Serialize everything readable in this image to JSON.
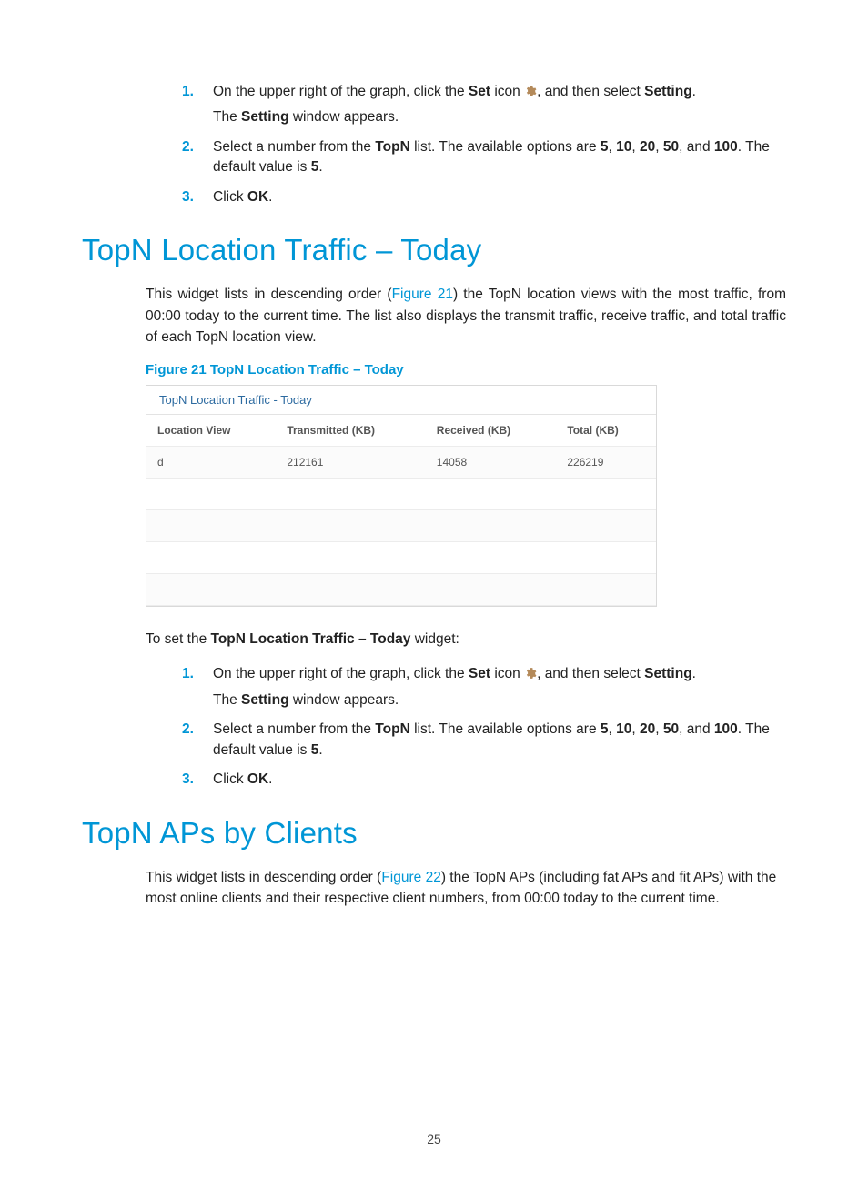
{
  "steps_a": {
    "n1": "1.",
    "t1_a": "On the upper right of the graph, click the ",
    "t1_b": "Set",
    "t1_c": " icon ",
    "t1_d": ", and then select ",
    "t1_e": "Setting",
    "t1_f": ".",
    "t1_sub_a": "The ",
    "t1_sub_b": "Setting",
    "t1_sub_c": " window appears.",
    "n2": "2.",
    "t2_a": "Select a number from the ",
    "t2_b": "TopN",
    "t2_c": " list. The available options are ",
    "t2_d": "5",
    "t2_e": ", ",
    "t2_f": "10",
    "t2_g": ", ",
    "t2_h": "20",
    "t2_i": ", ",
    "t2_j": "50",
    "t2_k": ", and ",
    "t2_l": "100",
    "t2_m": ". The default value is ",
    "t2_n": "5",
    "t2_o": ".",
    "n3": "3.",
    "t3_a": "Click ",
    "t3_b": "OK",
    "t3_c": "."
  },
  "section1": {
    "heading": "TopN Location Traffic – Today",
    "para_a": "This widget lists in descending order (",
    "para_link": "Figure 21",
    "para_b": ") the TopN location views with the most traffic, from 00:00 today to the current time. The list also displays the transmit traffic, receive traffic, and total traffic of each TopN location view.",
    "fig_caption": "Figure 21 TopN Location Traffic – Today",
    "panel_title": "TopN Location Traffic - Today",
    "intro_a": "To set the ",
    "intro_b": "TopN Location Traffic – Today",
    "intro_c": " widget:"
  },
  "chart_data": {
    "type": "table",
    "title": "TopN Location Traffic - Today",
    "columns": [
      "Location View",
      "Transmitted (KB)",
      "Received (KB)",
      "Total (KB)"
    ],
    "rows": [
      {
        "location": "d",
        "transmitted": "212161",
        "received": "14058",
        "total": "226219"
      },
      {
        "location": "",
        "transmitted": "",
        "received": "",
        "total": ""
      },
      {
        "location": "",
        "transmitted": "",
        "received": "",
        "total": ""
      },
      {
        "location": "",
        "transmitted": "",
        "received": "",
        "total": ""
      },
      {
        "location": "",
        "transmitted": "",
        "received": "",
        "total": ""
      }
    ]
  },
  "steps_b": {
    "n1": "1.",
    "t1_a": "On the upper right of the graph, click the ",
    "t1_b": "Set",
    "t1_c": " icon ",
    "t1_d": ", and then select ",
    "t1_e": "Setting",
    "t1_f": ".",
    "t1_sub_a": "The ",
    "t1_sub_b": "Setting",
    "t1_sub_c": " window appears.",
    "n2": "2.",
    "t2_a": "Select a number from the ",
    "t2_b": "TopN",
    "t2_c": " list. The available options are ",
    "t2_d": "5",
    "t2_e": ", ",
    "t2_f": "10",
    "t2_g": ", ",
    "t2_h": "20",
    "t2_i": ", ",
    "t2_j": "50",
    "t2_k": ", and ",
    "t2_l": "100",
    "t2_m": ". The default value is ",
    "t2_n": "5",
    "t2_o": ".",
    "n3": "3.",
    "t3_a": "Click ",
    "t3_b": "OK",
    "t3_c": "."
  },
  "section2": {
    "heading": "TopN APs by Clients",
    "para_a": "This widget lists in descending order (",
    "para_link": "Figure 22",
    "para_b": ") the TopN APs (including fat APs and fit APs) with the most online clients and their respective client numbers, from 00:00 today to the current time."
  },
  "page_number": "25"
}
